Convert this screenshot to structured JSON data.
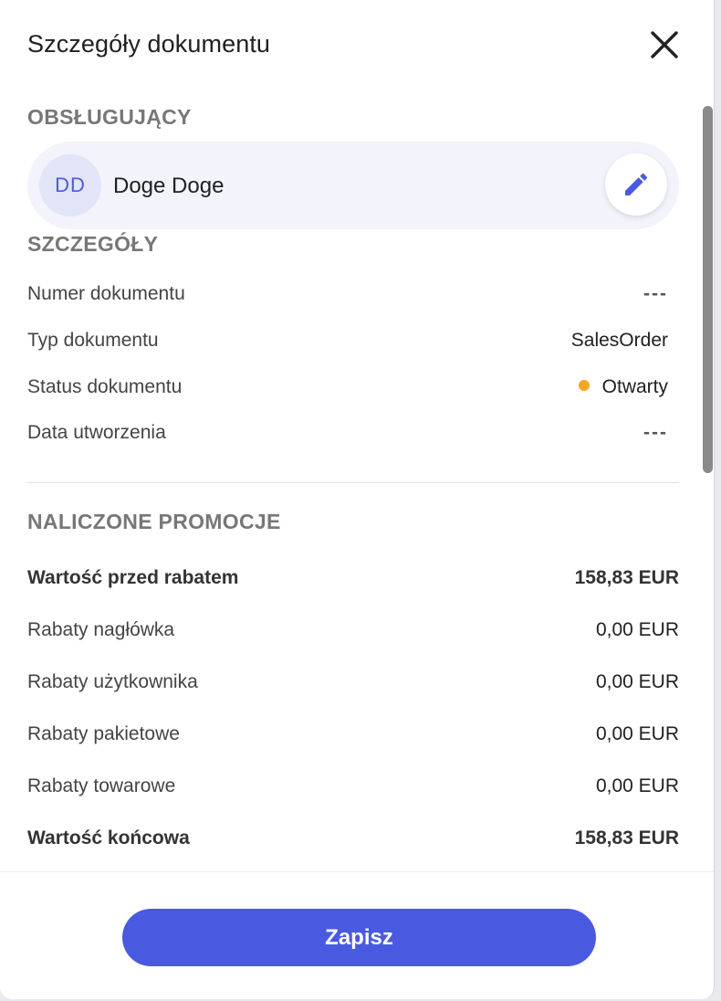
{
  "header": {
    "title": "Szczegóły dokumentu",
    "close_icon": "close-icon"
  },
  "handler": {
    "section_title": "OBSŁUGUJĄCY",
    "initials": "DD",
    "name": "Doge Doge",
    "edit_icon": "pencil-icon"
  },
  "details": {
    "section_title": "SZCZEGÓŁY",
    "rows": [
      {
        "label": "Numer dokumentu",
        "value": "---"
      },
      {
        "label": "Typ dokumentu",
        "value": "SalesOrder"
      },
      {
        "label": "Status dokumentu",
        "value": "Otwarty",
        "status_color": "#f5a623"
      },
      {
        "label": "Data utworzenia",
        "value": "---"
      }
    ]
  },
  "promotions": {
    "section_title": "NALICZONE PROMOCJE",
    "rows": [
      {
        "label": "Wartość przed rabatem",
        "value": "158,83 EUR",
        "bold": true
      },
      {
        "label": "Rabaty nagłówka",
        "value": "0,00 EUR"
      },
      {
        "label": "Rabaty użytkownika",
        "value": "0,00 EUR"
      },
      {
        "label": "Rabaty pakietowe",
        "value": "0,00 EUR"
      },
      {
        "label": "Rabaty towarowe",
        "value": "0,00 EUR"
      },
      {
        "label": "Wartość końcowa",
        "value": "158,83 EUR",
        "bold": true
      }
    ]
  },
  "footer": {
    "save_label": "Zapisz"
  },
  "colors": {
    "accent": "#4a5ae0",
    "avatar_bg": "#e2e4f7",
    "card_bg": "#f2f3fb",
    "status_open": "#f5a623"
  }
}
